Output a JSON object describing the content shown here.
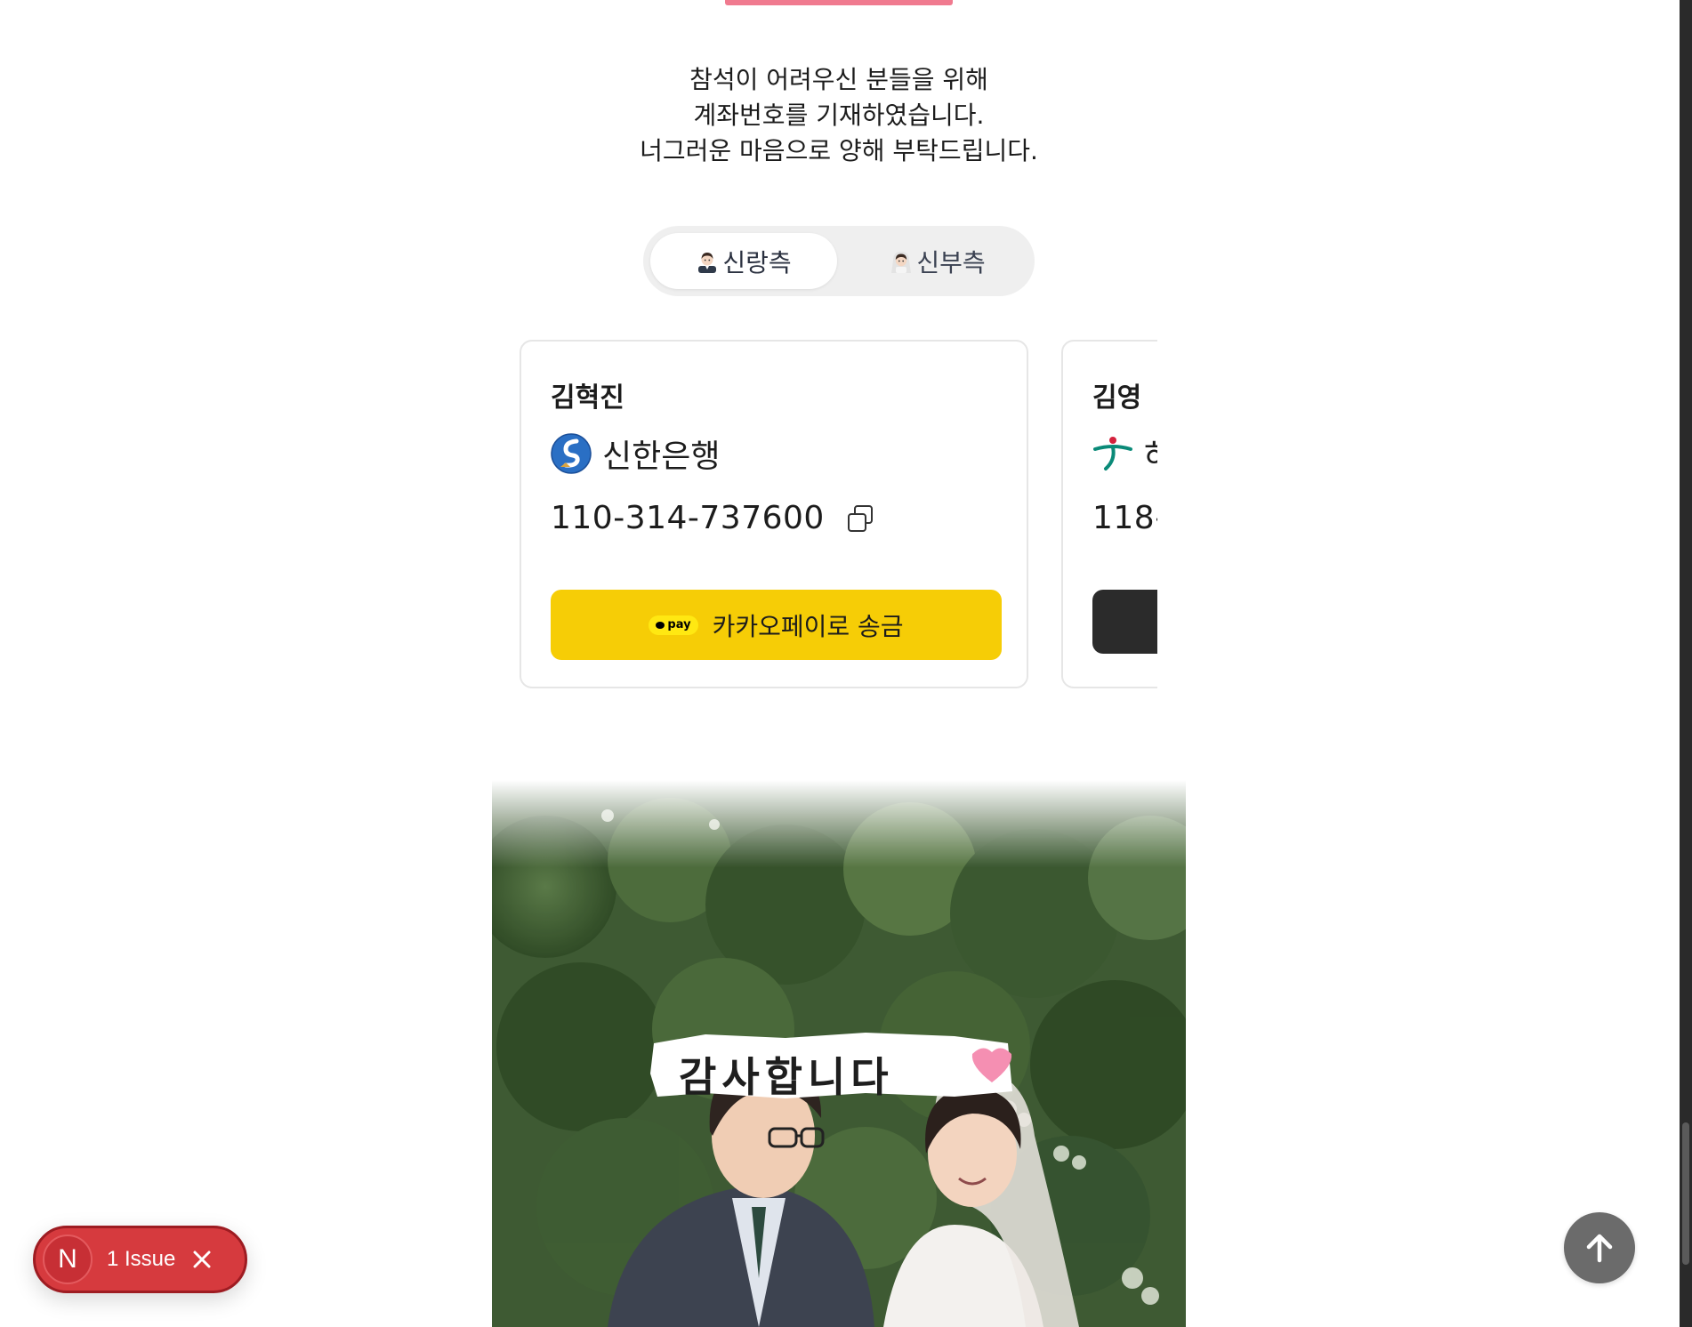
{
  "intro": {
    "line1": "참석이 어려우신 분들을 위해",
    "line2": "계좌번호를 기재하였습니다.",
    "line3": "너그러운 마음으로 양해 부탁드립니다."
  },
  "tabs": {
    "groom_label": "신랑측",
    "bride_label": "신부측",
    "selected": "신랑측"
  },
  "accounts": [
    {
      "holder": "김혁진",
      "bank": "신한은행",
      "number": "110-314-737600",
      "pay_badge": "pay",
      "pay_label": "카카오페이로 송금"
    },
    {
      "holder": "김영",
      "bank": "하",
      "number": "118-"
    }
  ],
  "photo": {
    "caption": "감사합니다"
  },
  "dev_overlay": {
    "badge": "N",
    "issues": "1 Issue"
  },
  "colors": {
    "accent": "#f07a8f",
    "kakao_yellow": "#f6cd06",
    "issue_red": "#d63a3e"
  }
}
